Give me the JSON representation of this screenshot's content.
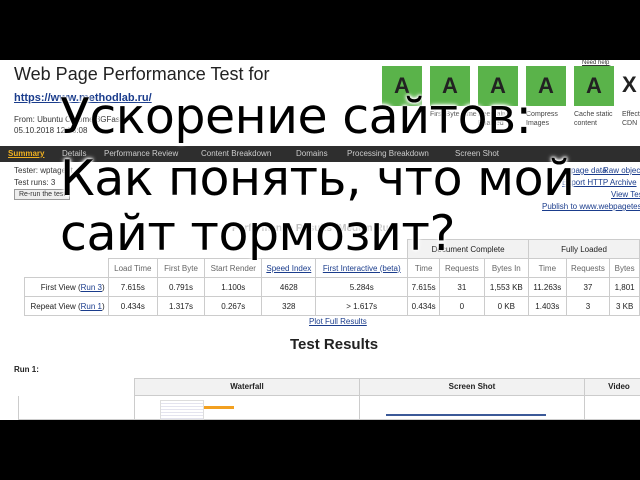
{
  "header": {
    "title": "Web Page Performance Test for",
    "url": "https://www.methodlab.ru/",
    "from": "From: Ubuntu  Chrome  3GFast",
    "date": "05.10.2018  12:55:08",
    "top_right_link": "Need help improving?"
  },
  "grades": [
    {
      "grade": "A",
      "label": ""
    },
    {
      "grade": "A",
      "label": "First Byte Time"
    },
    {
      "grade": "A",
      "label": "Keep-alive Enabled"
    },
    {
      "grade": "A",
      "label": "Compress Images"
    },
    {
      "grade": "A",
      "label": "Cache static content"
    },
    {
      "grade": "X",
      "label": "Effective use of CDN"
    }
  ],
  "colors": {
    "grade_green": "#5ab34a",
    "nav_bg": "#2e2e2e",
    "nav_active": "#f0b020",
    "link": "#1a3c8c"
  },
  "nav": {
    "items": [
      "Summary",
      "Details",
      "Performance Review",
      "Content Breakdown",
      "Domains",
      "Processing Breakdown",
      "Screen Shot"
    ]
  },
  "info": {
    "tester": "Tester: wptagent",
    "test_runs": "Test runs: 3",
    "rerun_button": "Re-run the test"
  },
  "right_links": {
    "raw_data": "page data",
    "raw_object": "Raw object",
    "export_har": "Export HTTP Archive",
    "view_test": "View Test",
    "publish": "Publish to www.webpagetest"
  },
  "performance": {
    "heading": "Performance Results (Median Run)",
    "group_document": "Document Complete",
    "group_fully": "Fully Loaded",
    "columns": [
      "Load Time",
      "First Byte",
      "Start Render",
      "Speed Index",
      "First Interactive (beta)",
      "Time",
      "Requests",
      "Bytes In",
      "Time",
      "Requests",
      "Bytes"
    ],
    "rows": [
      {
        "label_prefix": "First View (",
        "label_link": "Run 3",
        "label_suffix": ")",
        "cells": [
          "7.615s",
          "0.791s",
          "1.100s",
          "4628",
          "5.284s",
          "7.615s",
          "31",
          "1,553 KB",
          "11.263s",
          "37",
          "1,801"
        ]
      },
      {
        "label_prefix": "Repeat View (",
        "label_link": "Run 1",
        "label_suffix": ")",
        "cells": [
          "0.434s",
          "1.317s",
          "0.267s",
          "328",
          "> 1.617s",
          "0.434s",
          "0",
          "0 KB",
          "1.403s",
          "3",
          "3 KB"
        ]
      }
    ],
    "plot_link": "Plot Full Results"
  },
  "test_results": {
    "heading": "Test Results",
    "run_label": "Run 1:",
    "columns": [
      "Waterfall",
      "Screen Shot",
      "Video"
    ]
  },
  "overlay": {
    "line1": "Ускорение сайтов:",
    "line2": "Как понять, что мой",
    "line3": "сайт тормозит?"
  }
}
